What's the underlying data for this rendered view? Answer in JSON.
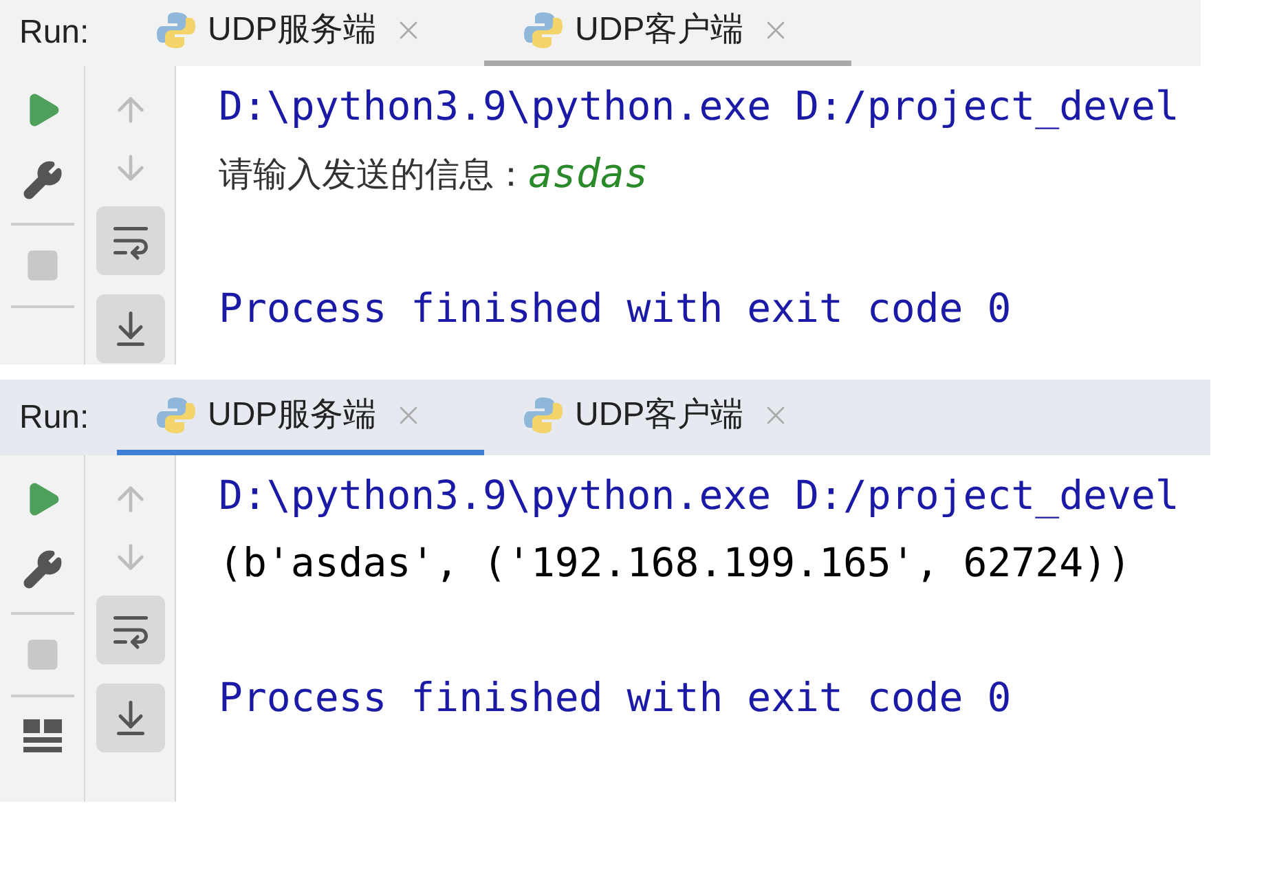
{
  "panels": [
    {
      "focused": false,
      "layout_button": false,
      "run_label": "Run:",
      "tabs": [
        {
          "label": "UDP服务端",
          "selected": false
        },
        {
          "label": "UDP客户端",
          "selected": true
        }
      ],
      "console": [
        {
          "kind": "path",
          "text": "D:\\python3.9\\python.exe D:/project_devel"
        },
        {
          "kind": "prompt",
          "text": "请输入发送的信息：",
          "input": "asdas"
        },
        {
          "kind": "blank"
        },
        {
          "kind": "exit",
          "text": "Process finished with exit code 0"
        }
      ]
    },
    {
      "focused": true,
      "layout_button": true,
      "run_label": "Run:",
      "tabs": [
        {
          "label": "UDP服务端",
          "selected": true
        },
        {
          "label": "UDP客户端",
          "selected": false
        }
      ],
      "console": [
        {
          "kind": "path",
          "text": "D:\\python3.9\\python.exe D:/project_devel"
        },
        {
          "kind": "output",
          "text": "(b'asdas', ('192.168.199.165', 62724))"
        },
        {
          "kind": "blank"
        },
        {
          "kind": "exit",
          "text": "Process finished with exit code 0"
        }
      ]
    }
  ]
}
